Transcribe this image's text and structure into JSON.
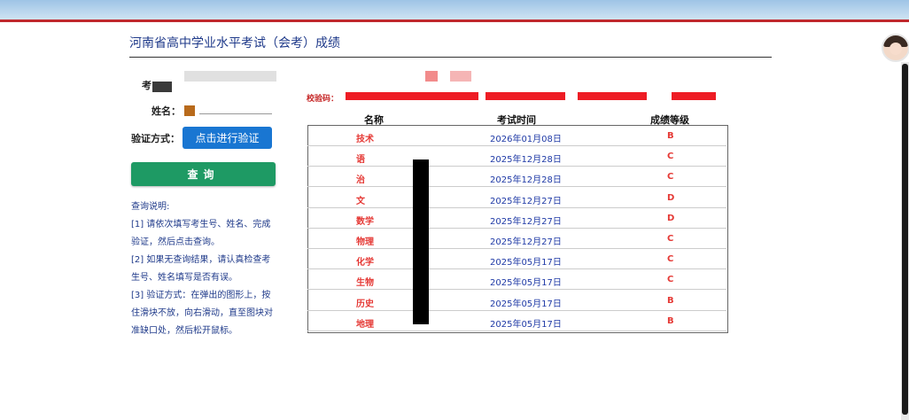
{
  "page": {
    "title": "河南省高中学业水平考试（会考）成绩"
  },
  "form": {
    "exam_number_label": "考",
    "name_label": "姓名：",
    "verify_label": "验证方式：",
    "verify_button": "点击进行验证",
    "query_button": "查询"
  },
  "notes": {
    "heading": "查询说明:",
    "line1": "[1] 请依次填写考生号、姓名、完成",
    "line2": "验证，然后点击查询。",
    "line3": "[2] 如果无查询结果，请认真检查考",
    "line4": "生号、姓名填写是否有误。",
    "line5": "[3] 验证方式：在弹出的图形上，按",
    "line6": "住滑块不放，向右滑动，直至图块对",
    "line7": "准缺口处，然后松开鼠标。"
  },
  "verification": {
    "code_label": "校验码："
  },
  "scores": {
    "headers": {
      "subject": "名称",
      "date": "考试时间",
      "grade": "成绩等级"
    },
    "rows": [
      {
        "subject": "技术",
        "date": "2026年01月08日",
        "grade": "B"
      },
      {
        "subject": "语",
        "date": "2025年12月28日",
        "grade": "C"
      },
      {
        "subject": "治",
        "date": "2025年12月28日",
        "grade": "C"
      },
      {
        "subject": "文",
        "date": "2025年12月27日",
        "grade": "D"
      },
      {
        "subject": "数学",
        "date": "2025年12月27日",
        "grade": "D"
      },
      {
        "subject": "物理",
        "date": "2025年12月27日",
        "grade": "C"
      },
      {
        "subject": "化学",
        "date": "2025年05月17日",
        "grade": "C"
      },
      {
        "subject": "生物",
        "date": "2025年05月17日",
        "grade": "C"
      },
      {
        "subject": "历史",
        "date": "2025年05月17日",
        "grade": "B"
      },
      {
        "subject": "地理",
        "date": "2025年05月17日",
        "grade": "B"
      }
    ]
  },
  "colors": {
    "brand_red": "#c0282d",
    "accent_blue": "#1976d2",
    "query_green": "#1e9a64",
    "grade_red": "#e53935"
  }
}
